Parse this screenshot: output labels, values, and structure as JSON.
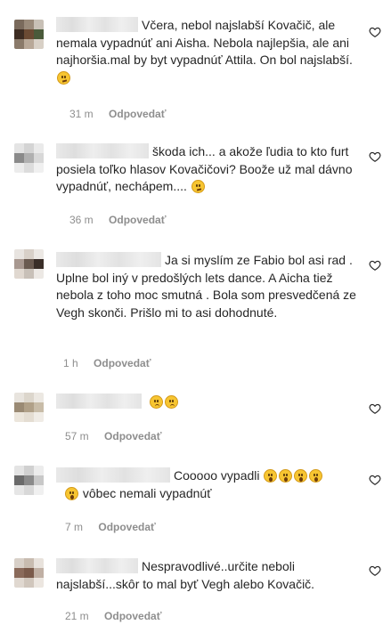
{
  "colors": {
    "text": "#262626",
    "secondary": "#8e8e8e",
    "background": "#ffffff"
  },
  "icons": {
    "like": "heart-outline-icon"
  },
  "comments": [
    {
      "text": "Včera, nebol najslabší Kovačič, ale nemala vypadnúť ani Aisha. Nebola najlepšia, ale ani najhoršia.mal by byt vypadnúť Attila. On bol najslabší.",
      "emoji": [
        "confused"
      ],
      "time": "31 m",
      "reply": "Odpovedať"
    },
    {
      "text": "škoda ich... a akože ľudia to kto furt posiela toľko hlasov Kovačičovi? Boože už mal dávno vypadnúť, nechápem....",
      "emoji": [
        "confused"
      ],
      "time": "36 m",
      "reply": "Odpovedať"
    },
    {
      "text": "Ja si myslím ze Fabio bol asi rad . Uplne bol iný v predošlých lets dance. A Aicha tiež nebola z toho moc smutná . Bola som presvedčená ze Vegh skonči. Prišlo mi to asi dohodnuté.",
      "emoji": [],
      "time": "1 h",
      "reply": "Odpovedať"
    },
    {
      "text": "",
      "emoji": [
        "sad",
        "sad"
      ],
      "time": "57 m",
      "reply": "Odpovedať"
    },
    {
      "text": "Cooooo vypadli",
      "text2": "vôbec nemali vypadnúť",
      "emoji": [
        "wow",
        "wow",
        "wow",
        "wow"
      ],
      "time": "7 m",
      "reply": "Odpovedať"
    },
    {
      "text": "Nespravodlivé..určite neboli najslabší...skôr to mal byť Vegh alebo Kovačič.",
      "emoji": [],
      "time": "21 m",
      "reply": "Odpovedať"
    }
  ]
}
